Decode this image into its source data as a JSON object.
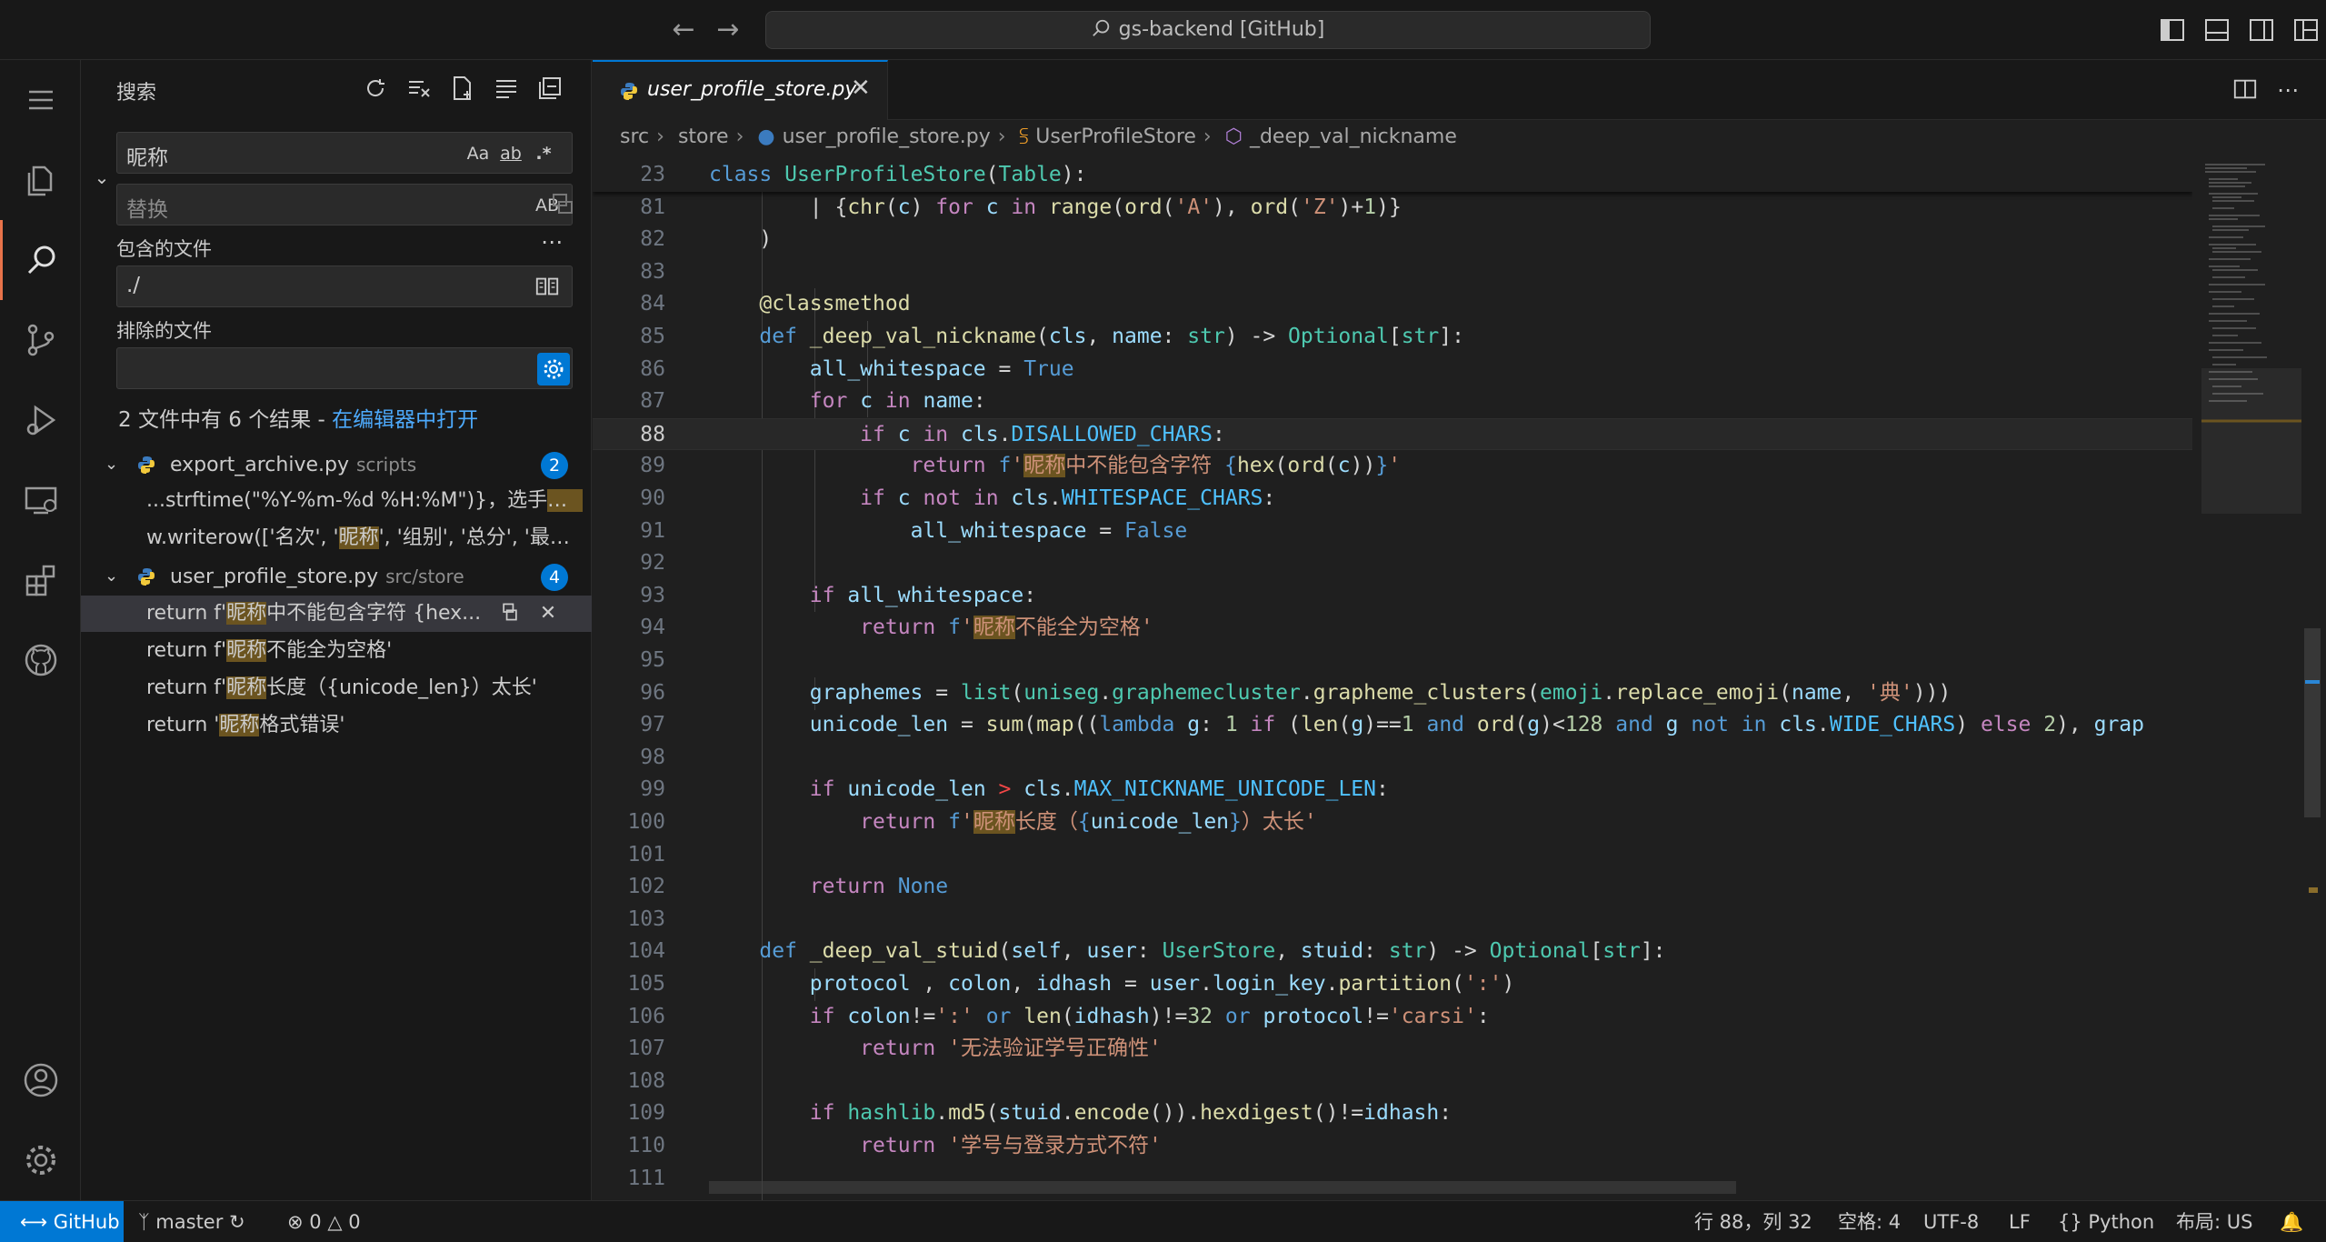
{
  "titlebar": {
    "back_icon": "arrow-left-icon",
    "forward_icon": "arrow-right-icon",
    "command_center": "gs-backend [GitHub]"
  },
  "activity_bar": [
    "files-icon",
    "search-icon",
    "source-control-icon",
    "run-debug-icon",
    "remote-explorer-icon",
    "extensions-icon",
    "github-icon",
    "account-icon",
    "gear-icon"
  ],
  "search": {
    "title": "搜索",
    "query": "昵称",
    "replace_placeholder": "替换",
    "include_label": "包含的文件",
    "include_value": "./",
    "exclude_label": "排除的文件",
    "exclude_value": "",
    "opt_case": "Aa",
    "opt_word": "ab",
    "opt_regex": ".*",
    "opt_preserve": "AB",
    "summary": "2 文件中有 6 个结果 - ",
    "open_in_editor": "在编辑器中打开",
    "results": [
      {
        "file": "export_archive.py",
        "path": "scripts",
        "count": "2",
        "matches": [
          {
            "pre": "...strftime(\"%Y-%m-%d %H:%M\")}，选手",
            "hit": "昵称",
            "post": "..."
          },
          {
            "pre": "w.writerow(['名次', '",
            "hit": "昵称",
            "post": "', '组别', '总分', '最后..."
          }
        ]
      },
      {
        "file": "user_profile_store.py",
        "path": "src/store",
        "count": "4",
        "matches": [
          {
            "pre": "return f'",
            "hit": "昵称",
            "post": "中不能包含字符 {hex..."
          },
          {
            "pre": "return f'",
            "hit": "昵称",
            "post": "不能全为空格'"
          },
          {
            "pre": "return f'",
            "hit": "昵称",
            "post": "长度（{unicode_len}）太长'"
          },
          {
            "pre": "return '",
            "hit": "昵称",
            "post": "格式错误'"
          }
        ]
      }
    ]
  },
  "editor": {
    "tab": "user_profile_store.py",
    "breadcrumb": [
      "src",
      "store",
      "user_profile_store.py",
      "UserProfileStore",
      "_deep_val_nickname"
    ]
  },
  "statusbar": {
    "remote": "GitHub",
    "branch": "master",
    "errors": "0",
    "warnings": "0",
    "position": "行 88，列 32",
    "spaces": "空格: 4",
    "encoding": "UTF-8",
    "eol": "LF",
    "language": "Python",
    "layout": "布局: US"
  },
  "colors": {
    "accent": "#0078d4",
    "active_indicator": "#e8734a",
    "match_highlight": "#6b5420"
  }
}
